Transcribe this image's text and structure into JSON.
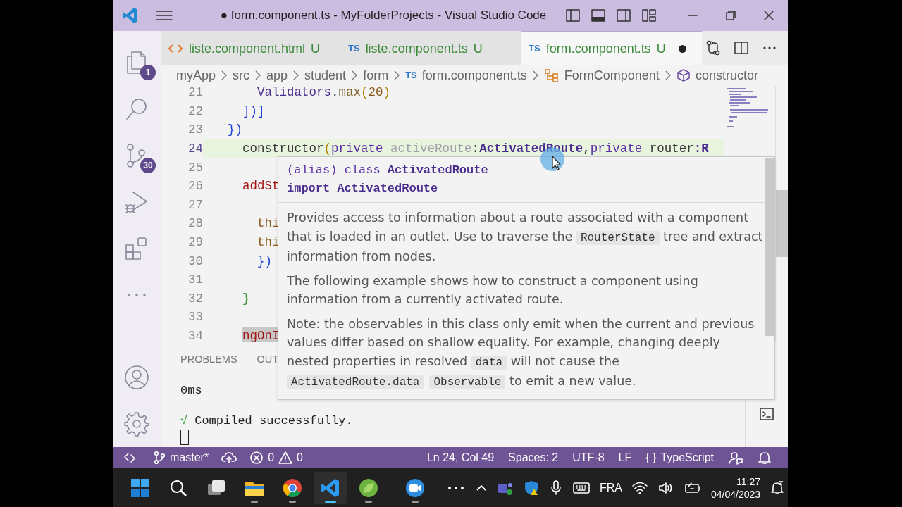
{
  "window": {
    "title": "● form.component.ts - MyFolderProjects - Visual Studio Code"
  },
  "activity_bar": {
    "top": [
      {
        "kind": "explorer",
        "badge": "1"
      },
      {
        "kind": "search"
      },
      {
        "kind": "source-control",
        "badge": "30"
      },
      {
        "kind": "run-debug"
      },
      {
        "kind": "extensions"
      },
      {
        "kind": "more"
      }
    ],
    "bottom": [
      {
        "kind": "account"
      },
      {
        "kind": "settings"
      }
    ]
  },
  "tabs": [
    {
      "kind": "html",
      "label": "liste.component.html",
      "status": "U",
      "selected": false,
      "dirty": false
    },
    {
      "kind": "ts",
      "type_label": "TS",
      "label": "liste.component.ts",
      "status": "U",
      "selected": false,
      "dirty": false
    },
    {
      "kind": "ts",
      "type_label": "TS",
      "label": "form.component.ts",
      "status": "U",
      "selected": true,
      "dirty": true
    }
  ],
  "breadcrumbs": [
    {
      "kind": "folder",
      "label": "myApp"
    },
    {
      "kind": "folder",
      "label": "src"
    },
    {
      "kind": "folder",
      "label": "app"
    },
    {
      "kind": "folder",
      "label": "student"
    },
    {
      "kind": "folder",
      "label": "form"
    },
    {
      "kind": "ts",
      "type_label": "TS",
      "label": "form.component.ts"
    },
    {
      "kind": "class",
      "label": "FormComponent"
    },
    {
      "kind": "method",
      "label": "constructor"
    }
  ],
  "editor": {
    "lines": [
      {
        "number": "21",
        "tokens": [
          {
            "text": "    Validators",
            "kind": "class"
          },
          {
            "text": ".",
            "kind": "plain"
          },
          {
            "text": "max",
            "kind": "method"
          },
          {
            "text": "(",
            "kind": "paren"
          },
          {
            "text": "20",
            "kind": "number"
          },
          {
            "text": ")",
            "kind": "paren"
          }
        ]
      },
      {
        "number": "22",
        "tokens": [
          {
            "text": "  ])",
            "kind": "bracket"
          },
          {
            "text": "]",
            "kind": "bracket"
          }
        ]
      },
      {
        "number": "23",
        "tokens": [
          {
            "text": "})",
            "kind": "bracket"
          }
        ]
      },
      {
        "number": "24",
        "highlighted": true,
        "tokens": [
          {
            "text": "  constructor",
            "kind": "plain"
          },
          {
            "text": "(",
            "kind": "paren"
          },
          {
            "text": "private ",
            "kind": "keyword"
          },
          {
            "text": "activeRoute",
            "kind": "unused"
          },
          {
            "text": ":",
            "kind": "plain"
          },
          {
            "text": "ActivatedRoute",
            "kind": "type"
          },
          {
            "text": ",",
            "kind": "plain"
          },
          {
            "text": "private ",
            "kind": "keyword"
          },
          {
            "text": "router",
            "kind": "plain"
          },
          {
            "text": ":R",
            "kind": "type"
          }
        ]
      },
      {
        "number": "25"
      },
      {
        "number": "26",
        "tokens": [
          {
            "text": "  addSt",
            "kind": "member"
          }
        ]
      },
      {
        "number": "27"
      },
      {
        "number": "28",
        "tokens": [
          {
            "text": "    thi",
            "kind": "this"
          }
        ]
      },
      {
        "number": "29",
        "tokens": [
          {
            "text": "    thi",
            "kind": "this"
          }
        ]
      },
      {
        "number": "30",
        "tokens": [
          {
            "text": "    })",
            "kind": "bracket"
          }
        ]
      },
      {
        "number": "31"
      },
      {
        "number": "32",
        "tokens": [
          {
            "text": "  }",
            "kind": "bracket2"
          }
        ]
      },
      {
        "number": "33"
      },
      {
        "number": "34",
        "shaded": true,
        "tokens": [
          {
            "text": "  ngOnI",
            "kind": "member"
          }
        ]
      }
    ]
  },
  "hover": {
    "signature": [
      [
        {
          "text": "(alias) ",
          "kind": "keyword"
        },
        {
          "text": "class ",
          "kind": "keyword"
        },
        {
          "text": "ActivatedRoute",
          "kind": "type"
        }
      ],
      [
        {
          "text": "import ",
          "kind": "type"
        },
        {
          "text": "ActivatedRoute",
          "kind": "type"
        }
      ]
    ],
    "paragraphs": [
      [
        {
          "text": "Provides access to information about a route associated with a component that is loaded in an outlet. Use to traverse the ",
          "kind": "text"
        },
        {
          "text": "RouterState",
          "kind": "code"
        },
        {
          "text": " tree and extract information from nodes.",
          "kind": "text"
        }
      ],
      [
        {
          "text": "The following example shows how to construct a component using information from a currently activated route.",
          "kind": "text"
        }
      ],
      [
        {
          "text": "Note: the observables in this class only emit when the current and previous values differ based on shallow equality. For example, changing deeply nested properties in resolved ",
          "kind": "text"
        },
        {
          "text": "data",
          "kind": "code"
        },
        {
          "text": " will not cause the ",
          "kind": "text"
        },
        {
          "text": "ActivatedRoute.data",
          "kind": "code"
        },
        {
          "text": "Observable",
          "kind": "code"
        },
        {
          "text": " to emit a new value.",
          "kind": "text"
        }
      ]
    ]
  },
  "panel": {
    "tabs": [
      {
        "label": "PROBLEMS",
        "selected": false
      },
      {
        "label": "OUT",
        "selected": false
      }
    ],
    "terminal": [
      {
        "text": "0ms"
      },
      {
        "check": "√",
        "text": "Compiled successfully."
      }
    ],
    "cursor": true
  },
  "status_bar": {
    "left": [
      {
        "kind": "remote"
      },
      {
        "kind": "branch",
        "text": "master*"
      },
      {
        "kind": "sync"
      },
      {
        "kind": "problems",
        "errors": "0",
        "warnings": "0"
      }
    ],
    "right": [
      {
        "kind": "text",
        "text": "Ln 24, Col 49"
      },
      {
        "kind": "text",
        "text": "Spaces: 2"
      },
      {
        "kind": "text",
        "text": "UTF-8"
      },
      {
        "kind": "text",
        "text": "LF"
      },
      {
        "kind": "language",
        "braces": "{ }",
        "text": "TypeScript"
      },
      {
        "kind": "feedback"
      },
      {
        "kind": "bell"
      }
    ]
  },
  "taskbar": {
    "apps": [
      {
        "kind": "start",
        "running": false,
        "selected": false
      },
      {
        "kind": "search",
        "running": false,
        "selected": false
      },
      {
        "kind": "task-view",
        "running": false,
        "selected": false
      },
      {
        "kind": "folder",
        "running": true,
        "selected": false
      },
      {
        "kind": "browser",
        "running": true,
        "selected": false
      },
      {
        "kind": "code",
        "running": true,
        "selected": true
      },
      {
        "kind": "leaf",
        "running": true,
        "selected": false
      },
      {
        "kind": "camera",
        "running": true,
        "selected": false
      },
      {
        "kind": "more",
        "running": false,
        "selected": false
      }
    ],
    "tray": [
      {
        "kind": "chevron"
      },
      {
        "kind": "people"
      },
      {
        "kind": "shield"
      },
      {
        "kind": "mic"
      },
      {
        "kind": "keyboard"
      },
      {
        "kind": "language",
        "text": "FRA"
      },
      {
        "kind": "wifi"
      },
      {
        "kind": "speaker"
      },
      {
        "kind": "battery"
      }
    ],
    "clock": {
      "time": "11:27",
      "date": "04/04/2023"
    }
  }
}
